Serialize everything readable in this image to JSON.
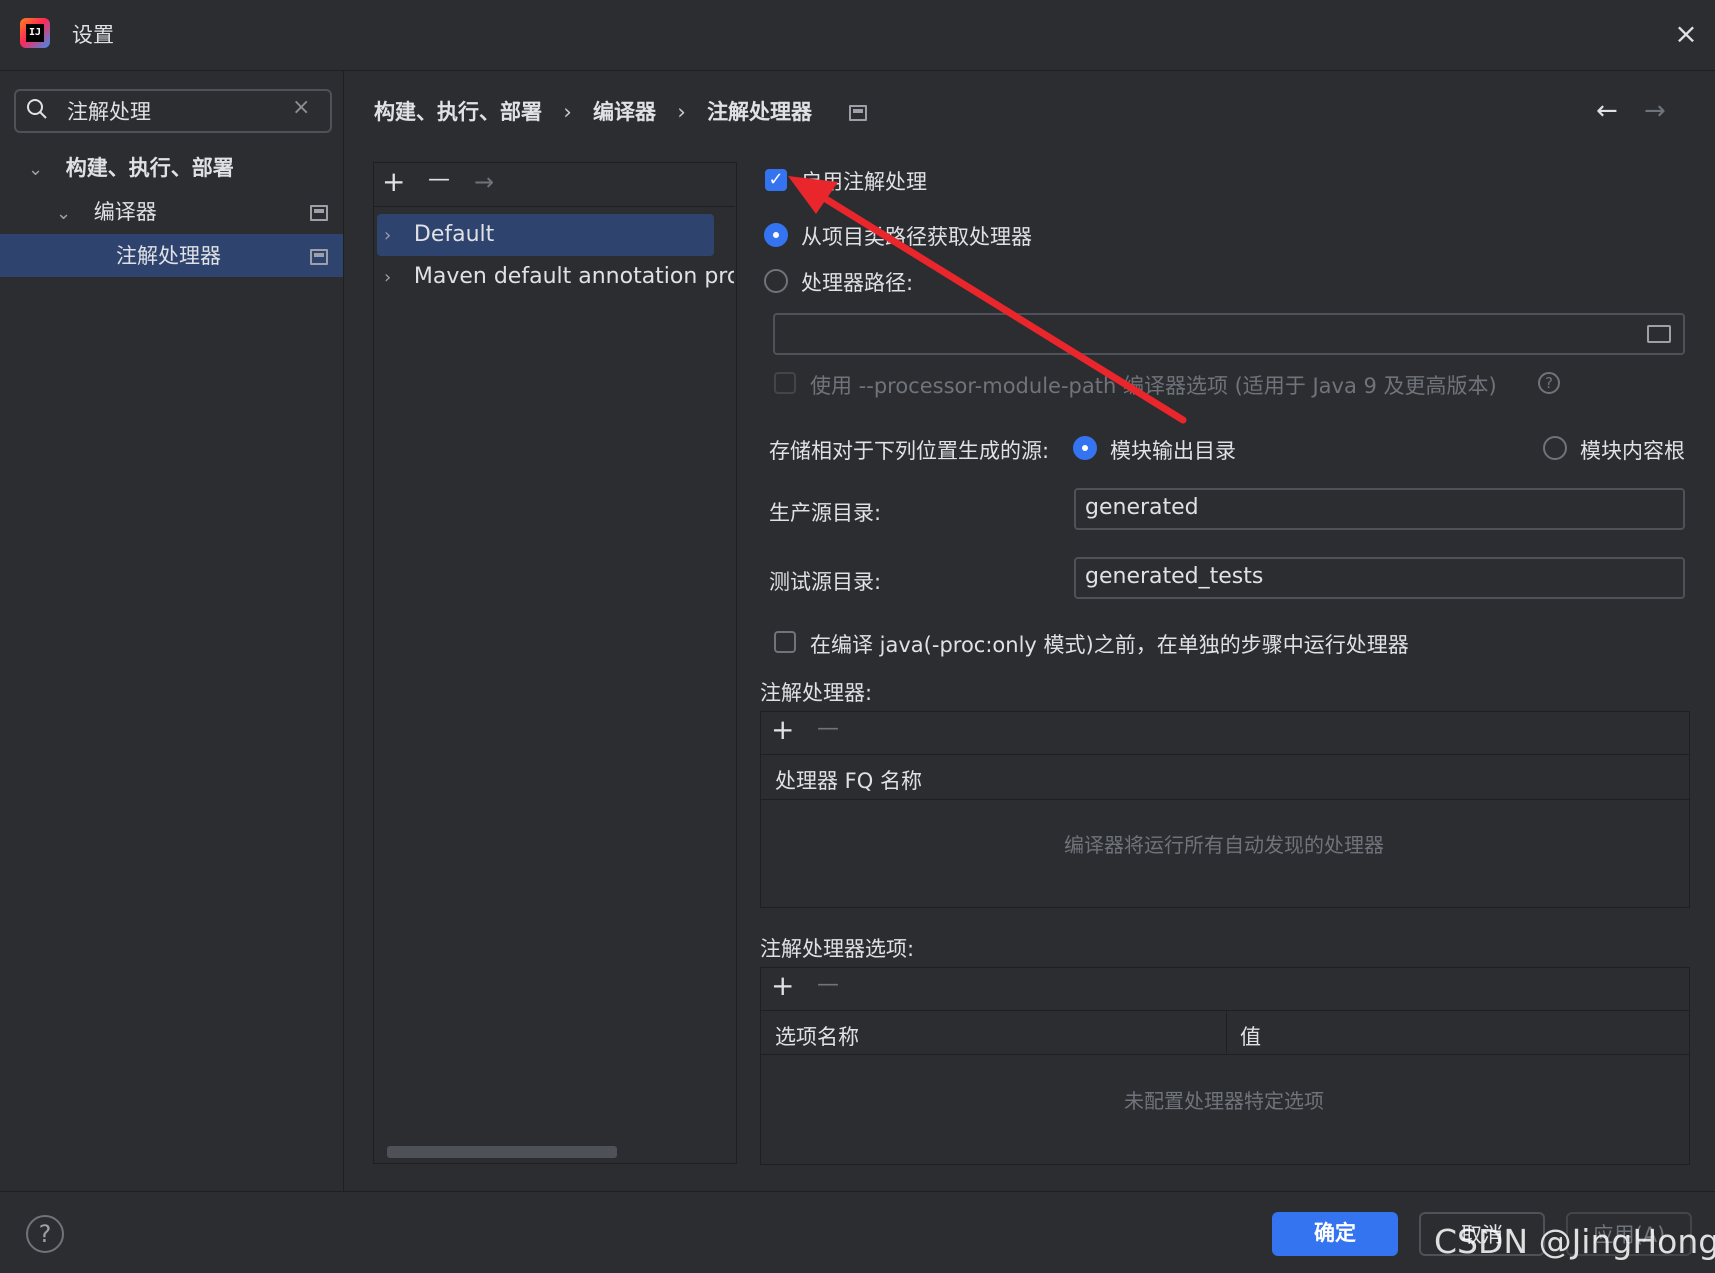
{
  "window": {
    "title": "设置",
    "close_glyph": "×"
  },
  "search": {
    "value": "注解处理",
    "clear_glyph": "×"
  },
  "tree": {
    "items": [
      {
        "label": "构建、执行、部署"
      },
      {
        "label": "编译器"
      },
      {
        "label": "注解处理器"
      }
    ]
  },
  "breadcrumb": {
    "parts": [
      "构建、执行、部署",
      "编译器",
      "注解处理器"
    ],
    "separator": "›"
  },
  "nav": {
    "back_glyph": "←",
    "forward_glyph": "→"
  },
  "profiles": {
    "toolbar": {
      "add": "+",
      "remove": "—",
      "move": "→"
    },
    "items": [
      {
        "label": "Default"
      },
      {
        "label": "Maven default annotation proc"
      }
    ]
  },
  "settings": {
    "enable_label": "启用注解处理",
    "from_classpath_label": "从项目类路径获取处理器",
    "processor_path_label": "处理器路径:",
    "processor_path_value": "",
    "module_path_label": "使用 --processor-module-path 编译器选项 (适用于 Java 9 及更高版本)",
    "store_label": "存储相对于下列位置生成的源:",
    "module_output_label": "模块输出目录",
    "content_root_label": "模块内容根",
    "prod_dir_label": "生产源目录:",
    "prod_dir_value": "generated",
    "test_dir_label": "测试源目录:",
    "test_dir_value": "generated_tests",
    "separate_step_label": "在编译 java(-proc:only 模式)之前，在单独的步骤中运行处理器"
  },
  "processors_table": {
    "title": "注解处理器:",
    "add": "+",
    "remove": "—",
    "column": "处理器 FQ 名称",
    "empty": "编译器将运行所有自动发现的处理器"
  },
  "options_table": {
    "title": "注解处理器选项:",
    "add": "+",
    "remove": "—",
    "col_name": "选项名称",
    "col_value": "值",
    "empty": "未配置处理器特定选项"
  },
  "footer": {
    "help": "?",
    "ok": "确定",
    "cancel": "取消",
    "apply": "应用(A)",
    "watermark": "CSDN @JingHongB"
  },
  "colors": {
    "accent": "#3574f0",
    "background": "#2b2d30",
    "selection": "#2e436e",
    "arrow": "#e8262b"
  }
}
